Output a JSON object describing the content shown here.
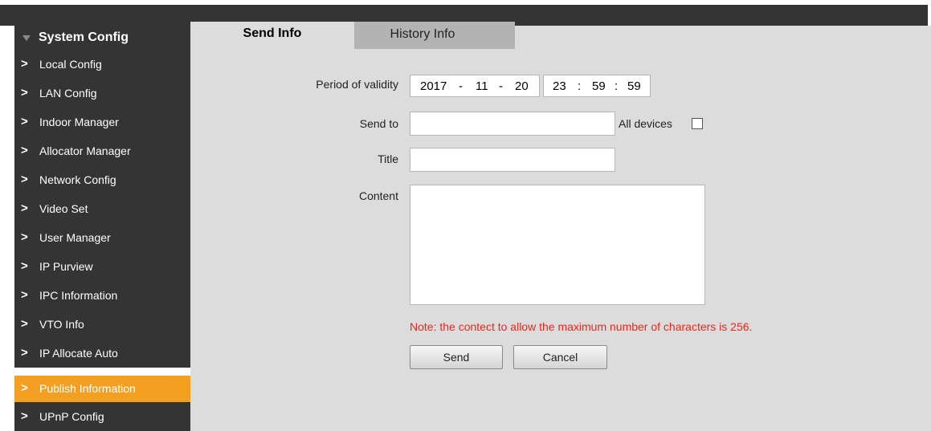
{
  "sidebar": {
    "header": "System Config",
    "items": [
      {
        "label": "Local Config"
      },
      {
        "label": "LAN Config"
      },
      {
        "label": "Indoor Manager"
      },
      {
        "label": "Allocator Manager"
      },
      {
        "label": "Network Config"
      },
      {
        "label": "Video Set"
      },
      {
        "label": "User Manager"
      },
      {
        "label": "IP Purview"
      },
      {
        "label": "IPC Information"
      },
      {
        "label": "VTO Info"
      },
      {
        "label": "IP Allocate Auto"
      },
      {
        "label": "Publish Information",
        "active": true
      },
      {
        "label": "UPnP Config"
      }
    ],
    "chevron": ">"
  },
  "tabs": {
    "send_info": "Send Info",
    "history_info": "History Info"
  },
  "form": {
    "validity_label": "Period of validity",
    "date": {
      "year": "2017",
      "month": "11",
      "day": "20",
      "sep": "-"
    },
    "time": {
      "hour": "23",
      "minute": "59",
      "second": "59",
      "sep": ":"
    },
    "send_to_label": "Send to",
    "send_to_value": "",
    "all_devices_label": "All devices",
    "title_label": "Title",
    "title_value": "",
    "content_label": "Content",
    "content_value": "",
    "note": "Note: the contect to allow the maximum number of characters is 256.",
    "send_button": "Send",
    "cancel_button": "Cancel"
  },
  "colors": {
    "sidebar_bg": "#343434",
    "active_item": "#f3a022",
    "main_bg": "#dcdcdc",
    "note_text": "#e8271a"
  }
}
